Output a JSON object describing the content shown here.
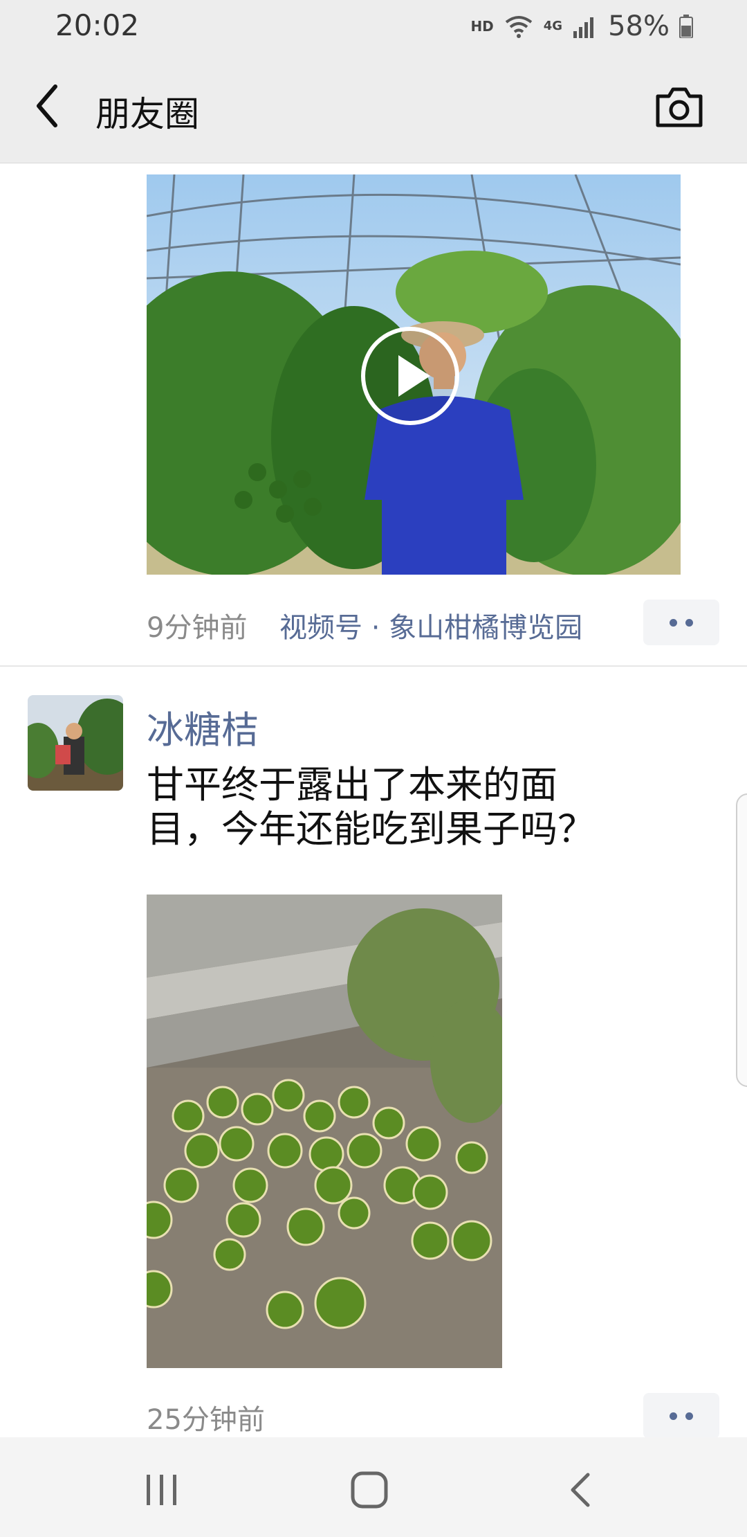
{
  "status_bar": {
    "time": "20:02",
    "hd_label": "HD",
    "network_label": "4G",
    "battery_percent": "58%",
    "icons": [
      "wifi-icon",
      "signal-icon",
      "battery-icon"
    ]
  },
  "nav": {
    "title": "朋友圈",
    "back_icon": "back-arrow-icon",
    "camera_icon": "camera-icon"
  },
  "posts": [
    {
      "media": "video",
      "time_ago": "9分钟前",
      "channel_label": "视频号 · 象山柑橘博览园"
    },
    {
      "author": "冰糖桔",
      "text_lines": [
        "甘平终于露出了本来的面",
        "目，今年还能吃到果子吗？"
      ],
      "media": "photo",
      "time_ago": "25分钟前"
    }
  ],
  "system_nav": {
    "icons": [
      "recent-apps-icon",
      "home-icon",
      "back-icon"
    ]
  },
  "colors": {
    "bar_background": "#ededed",
    "link_blue": "#576b95",
    "meta_gray": "#8a8a8a"
  }
}
